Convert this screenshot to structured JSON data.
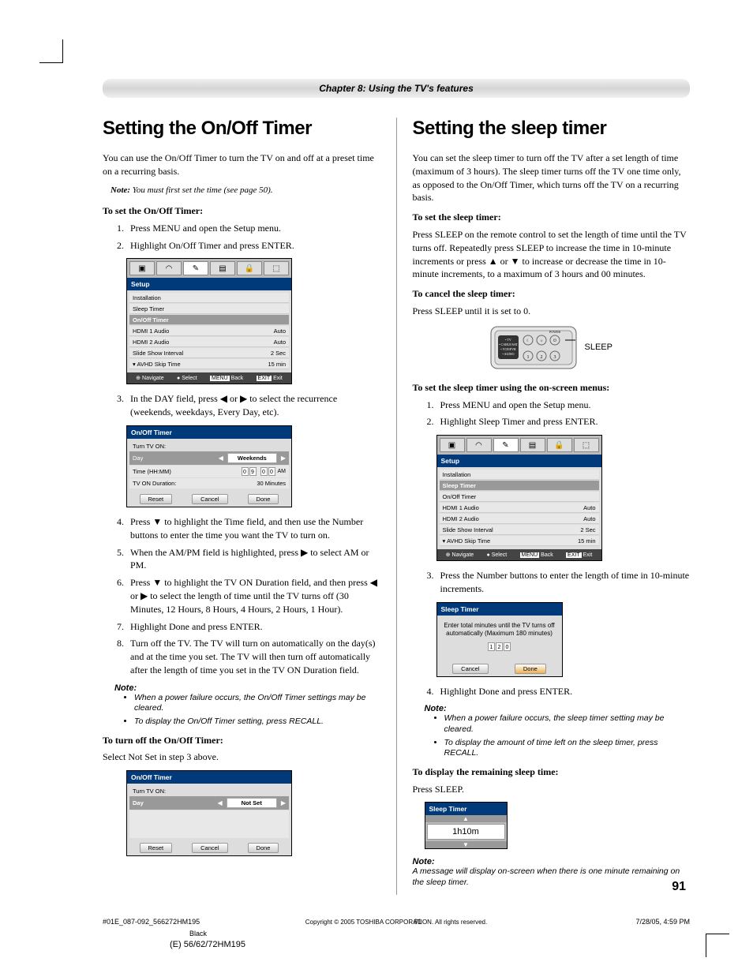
{
  "chapter": "Chapter 8: Using the TV's features",
  "left": {
    "heading": "Setting the On/Off Timer",
    "intro": "You can use the On/Off Timer to turn the TV on and off at a preset time on a recurring basis.",
    "note_first": "You must first set the time (see page 50).",
    "set_head": "To set the On/Off Timer:",
    "steps": {
      "s1": "Press MENU and open the Setup menu.",
      "s2": "Highlight On/Off Timer and press ENTER.",
      "s3": "In the DAY field, press ◀ or ▶ to select the recurrence (weekends, weekdays, Every Day, etc).",
      "s4": "Press ▼ to highlight the Time field, and then use the Number buttons to enter the time you want the TV to turn on.",
      "s5": "When the AM/PM field is highlighted, press ▶ to select AM or PM.",
      "s6": "Press ▼ to highlight the TV ON Duration field, and then press ◀ or ▶ to select the length of time until the TV turns off (30 Minutes, 12 Hours, 8 Hours, 4 Hours, 2 Hours, 1 Hour).",
      "s7": "Highlight Done and press ENTER.",
      "s8": "Turn off the TV. The TV will turn on automatically on the day(s) and at the time you set. The TV will then turn off automatically after the length of time you set in the TV ON Duration field."
    },
    "note_title": "Note:",
    "note_b1": "When a power failure occurs, the On/Off Timer settings may be cleared.",
    "note_b2": "To display the On/Off Timer setting, press RECALL.",
    "turnoff_head": "To turn off the On/Off Timer:",
    "turnoff_body": "Select Not Set in step 3 above."
  },
  "right": {
    "heading": "Setting the sleep timer",
    "intro": "You can set the sleep timer to turn off the TV after a set length of time (maximum of 3 hours). The sleep timer turns off the TV one time only, as opposed to the On/Off Timer, which turns off the TV on a recurring basis.",
    "set_head": "To set the sleep timer:",
    "set_body": "Press SLEEP on the remote control to set the length of time until the TV turns off. Repeatedly press SLEEP to increase the time in 10-minute increments or press ▲ or ▼ to increase or decrease the time in 10-minute increments, to a maximum of 3 hours and 00 minutes.",
    "cancel_head": "To cancel the sleep timer:",
    "cancel_body": "Press SLEEP until it is set to 0.",
    "sleep_label": "SLEEP",
    "osd_head": "To set the sleep timer using the on-screen menus:",
    "osd_steps": {
      "s1": "Press MENU and open the Setup menu.",
      "s2": "Highlight Sleep Timer and press ENTER.",
      "s3": "Press the Number buttons to enter the length of time in 10-minute increments.",
      "s4": "Highlight Done and press ENTER."
    },
    "note_title": "Note:",
    "note_b1": "When a power failure occurs, the sleep timer setting may be cleared.",
    "note_b2": "To display the amount of time left on the sleep timer, press RECALL.",
    "disp_head": "To display the remaining sleep time:",
    "disp_body": "Press SLEEP.",
    "note2": "A message will display on-screen when there is one minute remaining on the sleep timer."
  },
  "osd1": {
    "title": "Setup",
    "rows": [
      {
        "l": "Installation",
        "r": ""
      },
      {
        "l": "Sleep Timer",
        "r": ""
      },
      {
        "l": "On/Off Timer",
        "r": "",
        "sel": true
      },
      {
        "l": "HDMI 1 Audio",
        "r": "Auto"
      },
      {
        "l": "HDMI 2 Audio",
        "r": "Auto"
      },
      {
        "l": "Slide Show Interval",
        "r": "2 Sec"
      },
      {
        "l": "AVHD Skip Time",
        "r": "15 min"
      }
    ],
    "footer": [
      "Navigate",
      "Select",
      "Back",
      "Exit"
    ],
    "footer_keys": [
      "",
      "",
      "MENU",
      "EXIT"
    ]
  },
  "osd2": {
    "title": "On/Off Timer",
    "turn_on": "Turn TV ON:",
    "day_label": "Day",
    "day_val": "Weekends",
    "time_label": "Time (HH:MM)",
    "time_digits": [
      "0",
      "9",
      "0",
      "0"
    ],
    "time_ampm": "AM",
    "dur_label": "TV ON Duration:",
    "dur_val": "30 Minutes",
    "btns": [
      "Reset",
      "Cancel",
      "Done"
    ]
  },
  "osd3": {
    "title": "On/Off Timer",
    "turn_on": "Turn TV ON:",
    "day_label": "Day",
    "day_val": "Not Set",
    "btns": [
      "Reset",
      "Cancel",
      "Done"
    ]
  },
  "osd_sleep_menu": {
    "title": "Setup",
    "rows": [
      {
        "l": "Installation",
        "r": ""
      },
      {
        "l": "Sleep Timer",
        "r": "",
        "sel": true
      },
      {
        "l": "On/Off Timer",
        "r": ""
      },
      {
        "l": "HDMI 1 Audio",
        "r": "Auto"
      },
      {
        "l": "HDMI 2 Audio",
        "r": "Auto"
      },
      {
        "l": "Slide Show Interval",
        "r": "2 Sec"
      },
      {
        "l": "AVHD Skip Time",
        "r": "15 min"
      }
    ],
    "footer": [
      "Navigate",
      "Select",
      "Back",
      "Exit"
    ],
    "footer_keys": [
      "",
      "",
      "MENU",
      "EXIT"
    ]
  },
  "osd_sleep_input": {
    "title": "Sleep Timer",
    "msg": "Enter total minutes until the TV turns off automatically (Maximum 180 minutes)",
    "digits": [
      "1",
      "2",
      "0"
    ],
    "btns": [
      "Cancel",
      "Done"
    ]
  },
  "osd_sleep_remain": {
    "title": "Sleep Timer",
    "val": "1h10m"
  },
  "copyright": "Copyright © 2005 TOSHIBA CORPORATION. All rights reserved.",
  "page_num": "91",
  "footer": {
    "file": "#01E_087-092_566272HM195",
    "pg": "91",
    "date": "7/28/05, 4:59 PM",
    "color": "Black",
    "model": "(E) 56/62/72HM195"
  },
  "note_label": "Note:"
}
